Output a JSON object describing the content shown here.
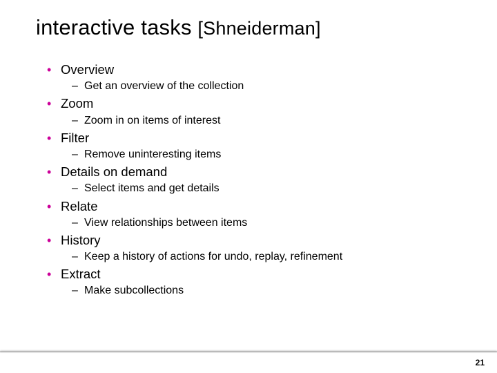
{
  "title_main": "interactive tasks ",
  "title_bracket": "[Shneiderman]",
  "items": [
    {
      "label": "Overview",
      "desc": "Get an overview of the collection"
    },
    {
      "label": "Zoom",
      "desc": "Zoom in on items of interest"
    },
    {
      "label": "Filter",
      "desc": "Remove uninteresting items"
    },
    {
      "label": "Details on demand",
      "desc": "Select items and get details"
    },
    {
      "label": "Relate",
      "desc": "View relationships between items"
    },
    {
      "label": "History",
      "desc": "Keep a history of actions for undo, replay, refinement"
    },
    {
      "label": "Extract",
      "desc": "Make subcollections"
    }
  ],
  "page_number": "21"
}
